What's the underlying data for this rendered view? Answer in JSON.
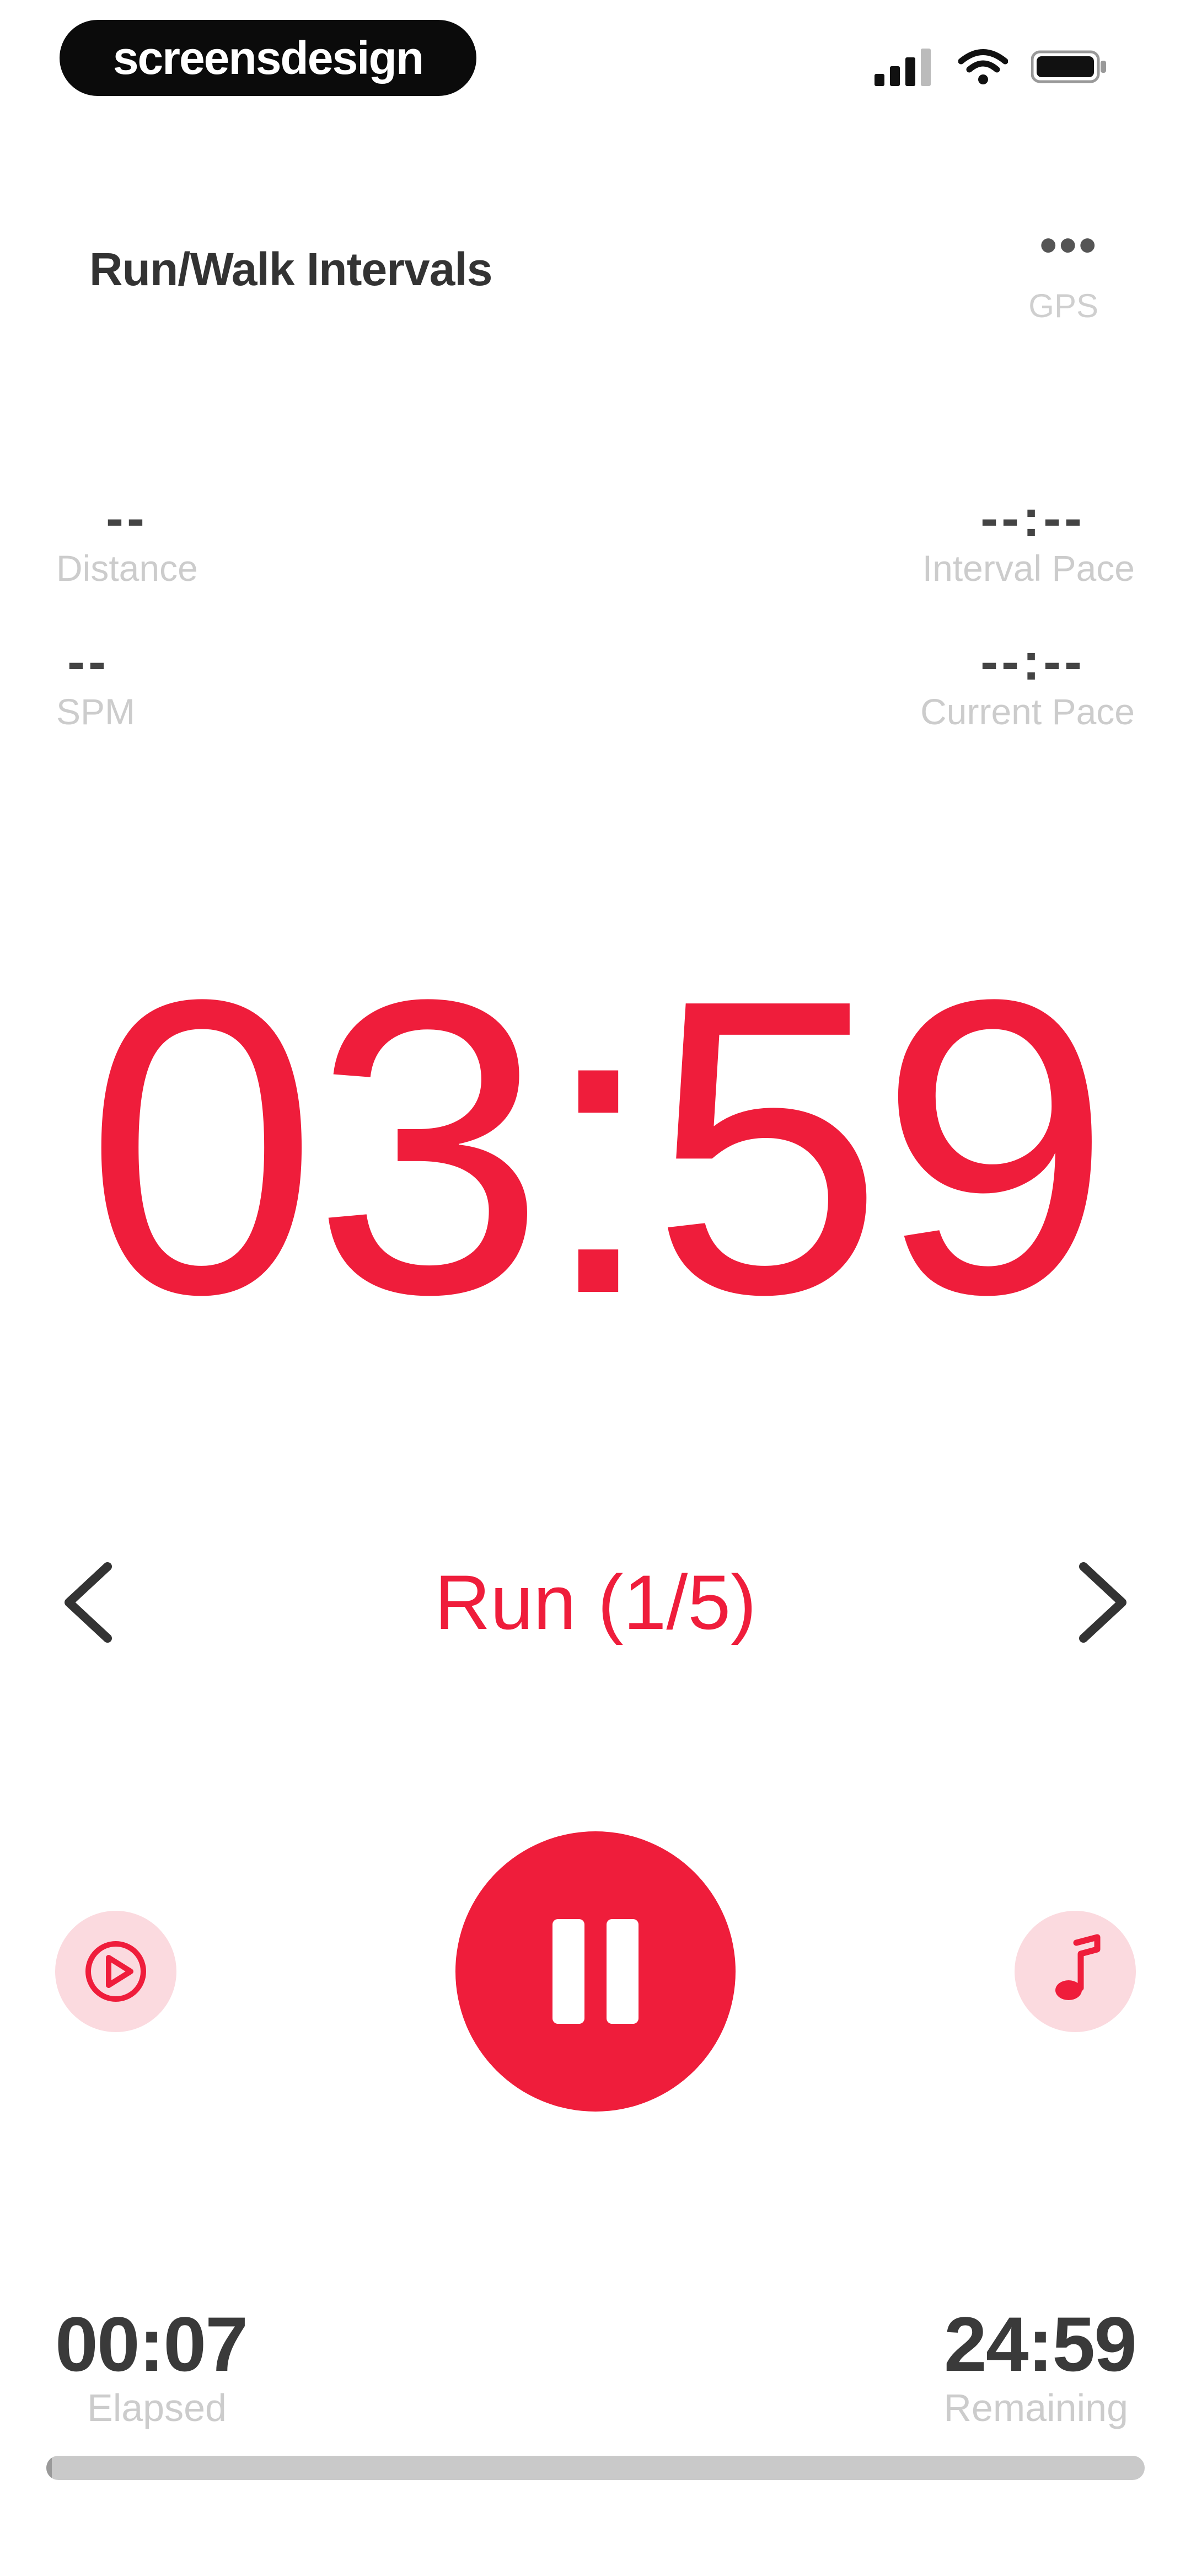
{
  "status_bar": {
    "brand": "screensdesign"
  },
  "header": {
    "title": "Run/Walk Intervals",
    "menu_glyph": "•••",
    "gps_label": "GPS"
  },
  "metrics": {
    "distance": {
      "value": "--",
      "label": "Distance"
    },
    "spm": {
      "value": "--",
      "label": "SPM"
    },
    "interval_pace": {
      "value": "--:--",
      "label": "Interval Pace"
    },
    "current_pace": {
      "value": "--:--",
      "label": "Current Pace"
    }
  },
  "timer": {
    "countdown": "03:59",
    "interval": "Run (1/5)"
  },
  "footer": {
    "elapsed": {
      "value": "00:07",
      "label": "Elapsed"
    },
    "remaining": {
      "value": "24:59",
      "label": "Remaining"
    },
    "progress_fraction": 0.005
  },
  "colors": {
    "accent": "#ef1d3b",
    "accent_soft": "#fbdadf",
    "muted_text": "#cccccc"
  },
  "icons": {
    "prev": "chevron-left-icon",
    "next": "chevron-right-icon",
    "pause": "pause-icon",
    "voice": "play-circle-icon",
    "music": "music-note-icon"
  }
}
